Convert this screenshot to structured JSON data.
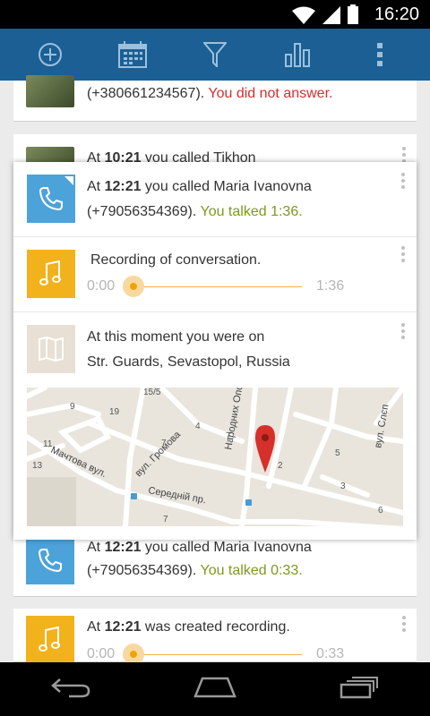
{
  "status_bar": {
    "time": "16:20"
  },
  "action_bar": {
    "icons": [
      "add-icon",
      "calendar-icon",
      "filter-icon",
      "bar-chart-icon",
      "overflow-menu-icon"
    ]
  },
  "background_list": {
    "item0": {
      "prefix": "(+380661234567). ",
      "status": "You did not answer."
    },
    "item1": {
      "text_pre": "At ",
      "time": "10:21",
      "text_post": " you called Tikhon"
    },
    "item2": {
      "text_pre": "At ",
      "time": "12:21",
      "text_post": " you called Maria Ivanovna",
      "phone": "(+79056354369). ",
      "status": "You talked 0:33."
    },
    "item3": {
      "text_pre": "At ",
      "time": "12:21",
      "text_post": " was created recording.",
      "player": {
        "start": "0:00",
        "end": "0:33"
      }
    }
  },
  "popup": {
    "call": {
      "text_pre": "At ",
      "time": "12:21",
      "text_post": " you called Maria Ivanovna",
      "phone": "(+79056354369). ",
      "status": "You talked 1:36."
    },
    "recording": {
      "title": "Recording of conversation.",
      "start": "0:00",
      "end": "1:36",
      "progress": 0.0
    },
    "location": {
      "line1": "At this moment you were on",
      "line2": "Str. Guards, Sevastopol, Russia"
    },
    "map_labels": {
      "street1": "Народних Ополченців",
      "street2": "вул. Громова",
      "street3": "Мачтова вул.",
      "street4": "Середній пр.",
      "street5": "вул. Слєп",
      "n1": "15/5",
      "n2": "7",
      "n3": "4",
      "n4": "13",
      "n5": "19",
      "n6": "2",
      "n7": "7",
      "n8": "5",
      "n9": "3",
      "n10": "6",
      "n11": "11",
      "n12": "9",
      "n13": "7"
    }
  },
  "colors": {
    "action_bar": "#1b5f94",
    "call_tile": "#4ca3d9",
    "recording_tile": "#f2b21c",
    "map_tile": "#e8e0d4",
    "talked_green": "#7c9a1c",
    "missed_red": "#d32f2f"
  }
}
